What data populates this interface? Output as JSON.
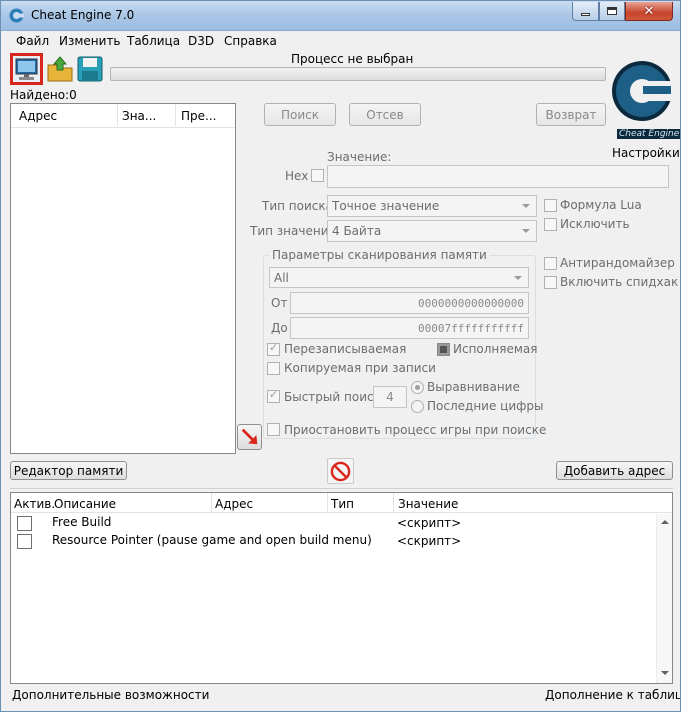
{
  "window": {
    "title": "Cheat Engine 7.0"
  },
  "menu": [
    "Файл",
    "Изменить",
    "Таблица",
    "D3D",
    "Справка"
  ],
  "process": {
    "label": "Процесс не выбран",
    "found": "Найдено:0"
  },
  "scan_list": {
    "columns": [
      "Адрес",
      "Зна...",
      "Пре..."
    ]
  },
  "buttons": {
    "first_scan": "Поиск",
    "next_scan": "Отсев",
    "undo": "Возврат",
    "settings": "Настройки",
    "memory_view": "Редактор памяти",
    "add_address": "Добавить адрес"
  },
  "logo_text": "Cheat Engine",
  "value": {
    "label": "Значение:",
    "hex_label": "Hex",
    "text": ""
  },
  "scan_type": {
    "label": "Тип поиска",
    "selected": "Точное значение"
  },
  "value_type": {
    "label": "Тип значения",
    "selected": "4 Байта"
  },
  "options_right": {
    "lua": "Формула Lua",
    "not": "Исключить",
    "unrandomizer": "Антирандомайзер",
    "speedhack": "Включить спидхак"
  },
  "memory_options": {
    "title": "Параметры сканирования памяти",
    "region": "All",
    "from_label": "От",
    "from_value": "0000000000000000",
    "to_label": "До",
    "to_value": "00007fffffffffff",
    "writable": "Перезаписываемая",
    "executable": "Исполняемая",
    "copy_on_write": "Копируемая при записи",
    "fast_scan": "Быстрый поиск",
    "fast_scan_value": "4",
    "alignment": "Выравнивание",
    "last_digits": "Последние цифры",
    "pause": "Приостановить процесс игры при поиске"
  },
  "cheat_table": {
    "columns": [
      "Актив.",
      "Описание",
      "Адрес",
      "Тип",
      "Значение"
    ],
    "rows": [
      {
        "description": "Free Build",
        "value": "<скрипт>"
      },
      {
        "description": "Resource Pointer (pause game and open build menu)",
        "value": "<скрипт>"
      }
    ]
  },
  "status": {
    "left": "Дополнительные возможности",
    "right": "Дополнение к таблице"
  },
  "colors": {
    "accent": "#1f6aa8",
    "logo": "#1d5f86",
    "highlight": "#d9261c"
  }
}
